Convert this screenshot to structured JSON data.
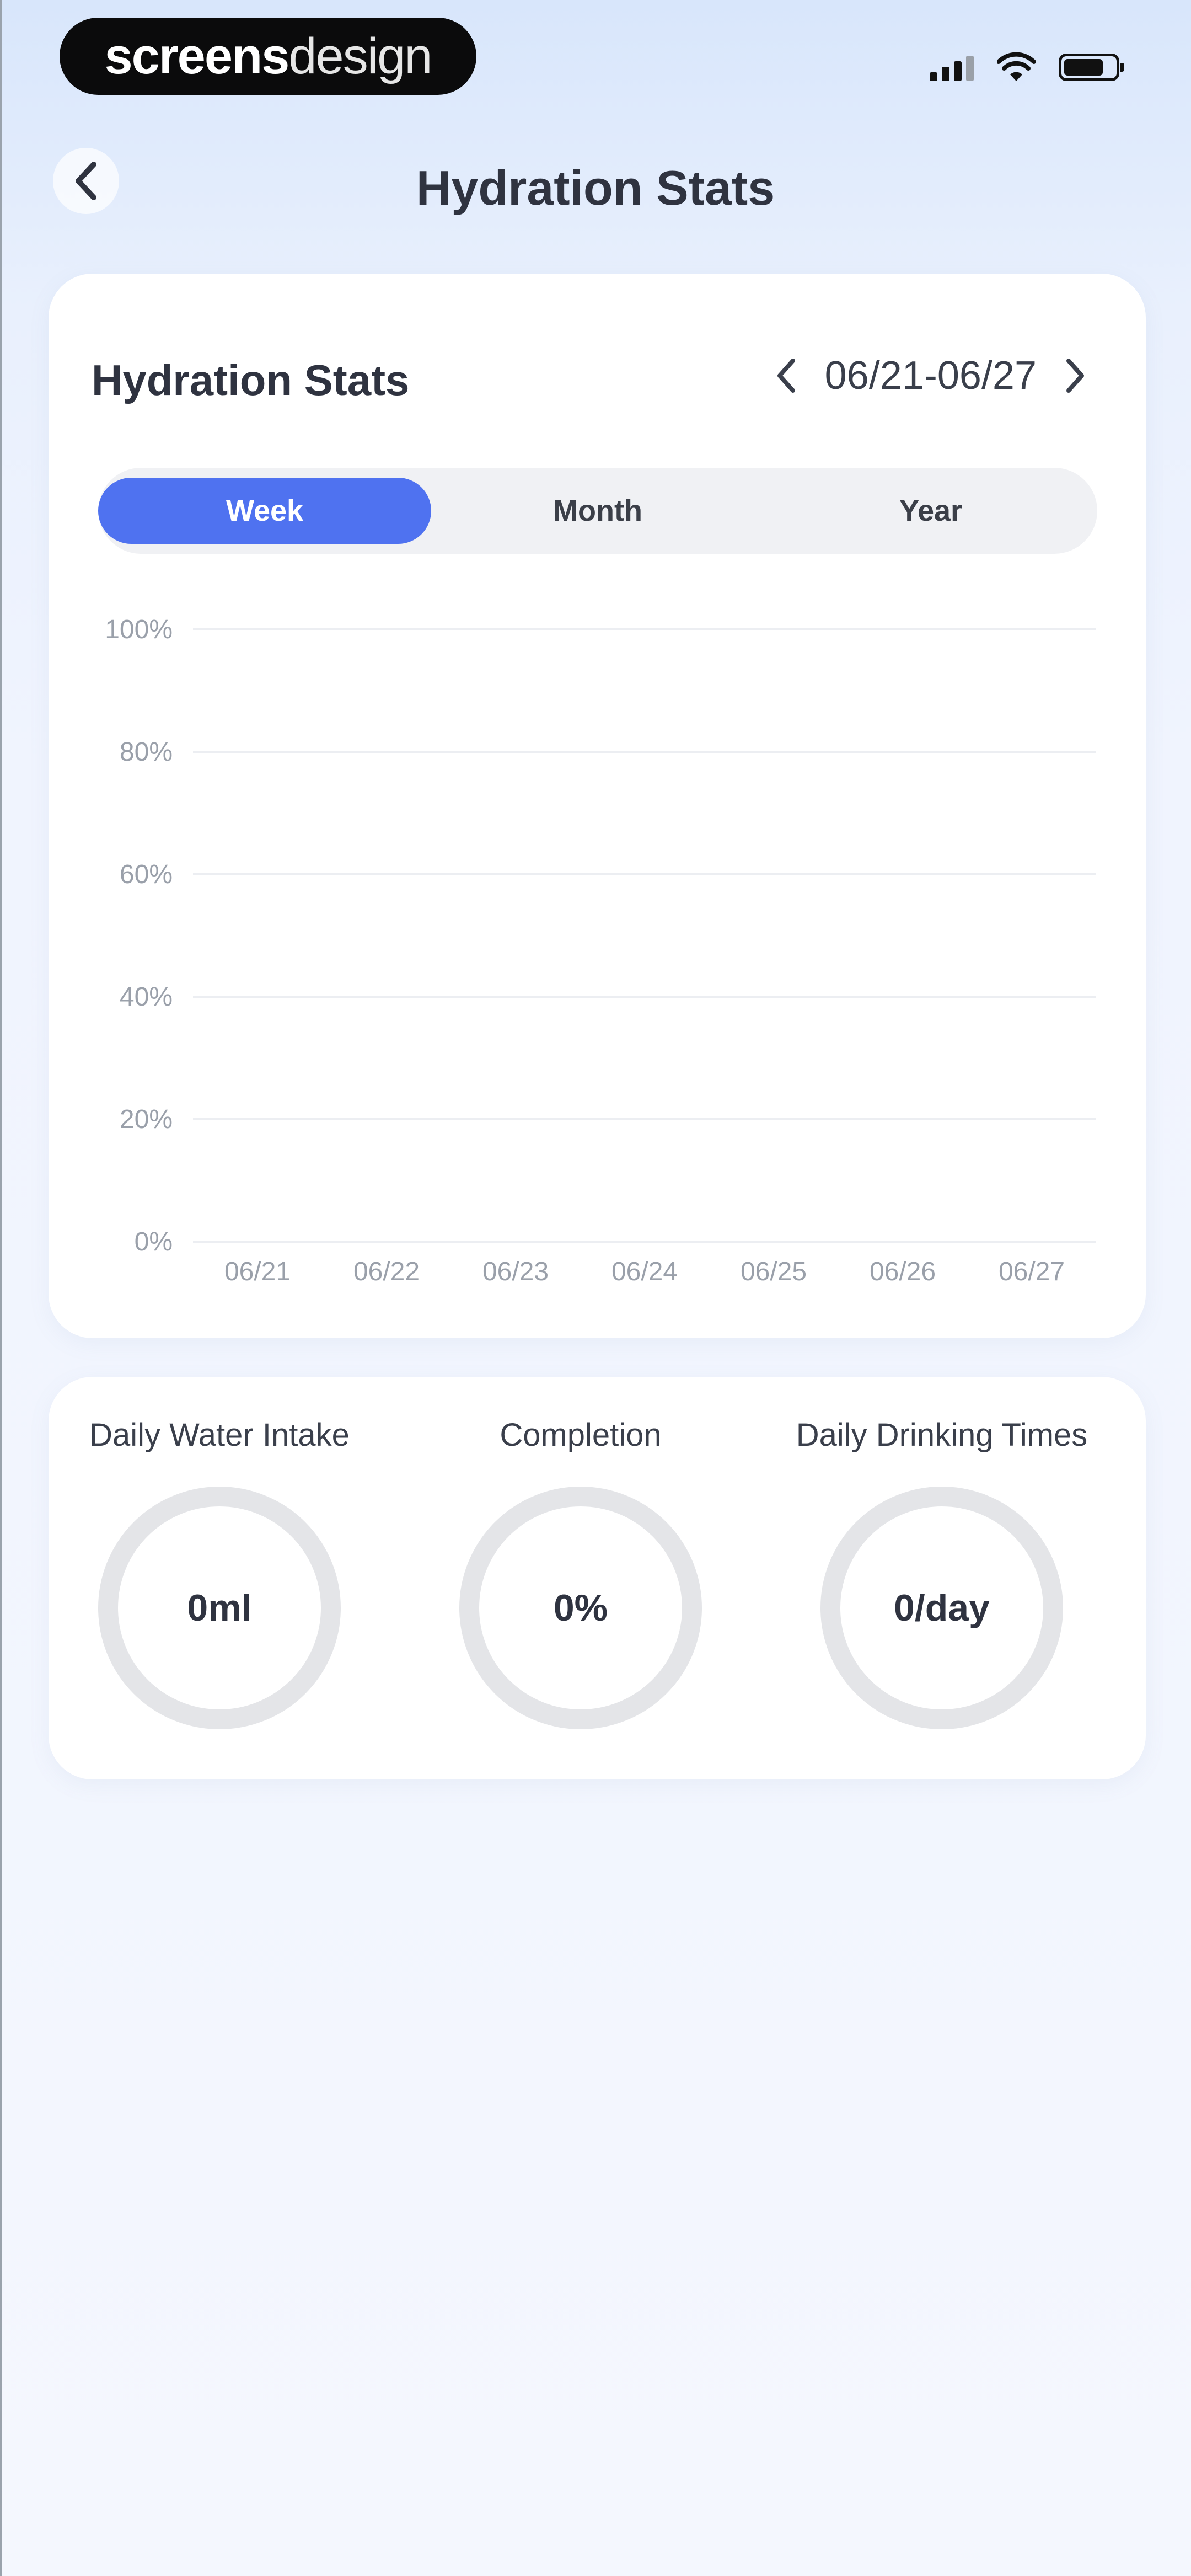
{
  "status_bar": {
    "brand_bold": "screens",
    "brand_light": "design"
  },
  "header": {
    "title": "Hydration Stats",
    "back_icon": "chevron-left-icon"
  },
  "stats_card": {
    "title": "Hydration Stats",
    "range": "06/21-06/27",
    "prev_icon": "chevron-left-icon",
    "next_icon": "chevron-right-icon",
    "periods": [
      "Week",
      "Month",
      "Year"
    ],
    "active_period": "Week",
    "accent_color": "#4f72f0"
  },
  "chart_data": {
    "type": "bar",
    "categories": [
      "06/21",
      "06/22",
      "06/23",
      "06/24",
      "06/25",
      "06/26",
      "06/27"
    ],
    "values": [
      0,
      0,
      0,
      0,
      0,
      0,
      0
    ],
    "yticks": [
      "100%",
      "80%",
      "60%",
      "40%",
      "20%",
      "0%"
    ],
    "ylim": [
      0,
      100
    ],
    "grid": true
  },
  "summary": {
    "items": [
      {
        "label": "Daily Water Intake",
        "value": "0ml"
      },
      {
        "label": "Completion",
        "value": "0%"
      },
      {
        "label": "Daily Drinking Times",
        "value": "0/day"
      }
    ]
  }
}
